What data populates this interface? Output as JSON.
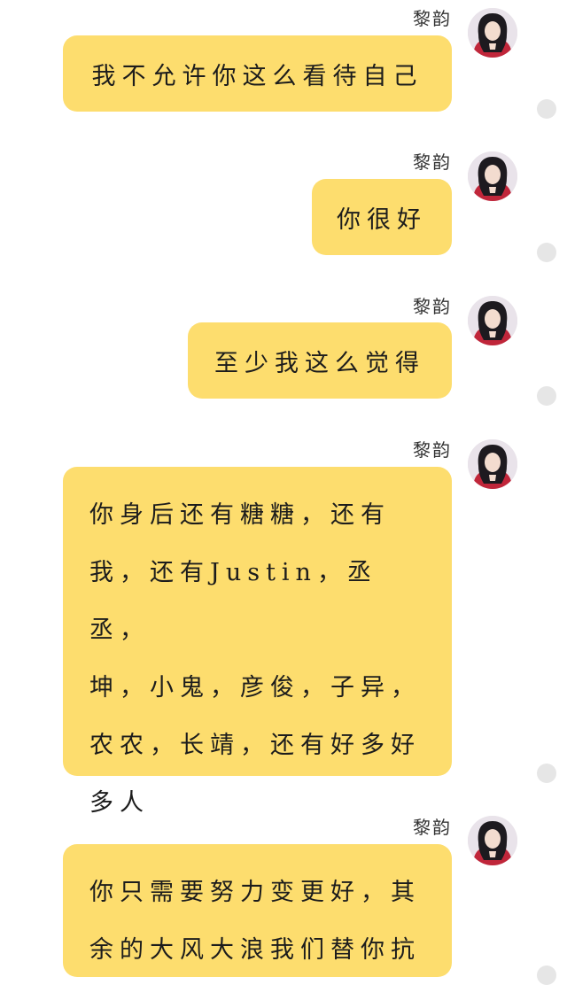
{
  "messages": [
    {
      "sender": "黎韵",
      "text": "我不允许你这么看待自己"
    },
    {
      "sender": "黎韵",
      "text": "你很好"
    },
    {
      "sender": "黎韵",
      "text": "至少我这么觉得"
    },
    {
      "sender": "黎韵",
      "lines": [
        "你身后还有糖糖，还有",
        "我，还有Justin，丞丞，",
        "坤，小鬼，彦俊，子异，",
        "农农，长靖，还有好多好",
        "多人"
      ]
    },
    {
      "sender": "黎韵",
      "lines": [
        "你只需要努力变更好，其",
        "余的大风大浪我们替你抗"
      ]
    }
  ],
  "colors": {
    "bubble": "#fddd6e",
    "background": "#ffffff",
    "status_dot": "#e6e6e6"
  },
  "icons": {
    "avatar": "avatar-portrait-icon",
    "status": "status-dot-icon"
  }
}
